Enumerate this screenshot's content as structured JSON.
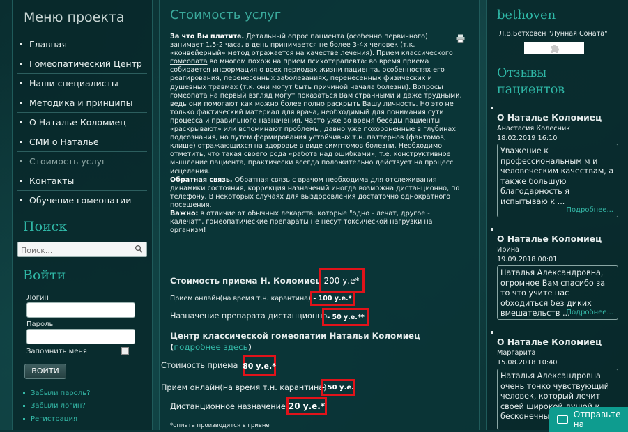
{
  "left": {
    "menu_title": "Меню проекта",
    "menu": [
      "Главная",
      "Гомеопатический Центр",
      "Наши специалисты",
      "Методика и принципы",
      "О Наталье Коломиец",
      "СМИ о Наталье",
      "Стоимость услуг",
      "Контакты",
      "Обучение гомеопатии"
    ],
    "search_title": "Поиск",
    "search_placeholder": "Поиск...",
    "login_title": "Войти",
    "login_label": "Логин",
    "password_label": "Пароль",
    "remember_label": "Запомнить меня",
    "login_button": "ВОЙТИ",
    "links": [
      "Забыли пароль?",
      "Забыли логин?",
      "Регистрация"
    ]
  },
  "main": {
    "title": "Стоимость услуг",
    "p1_bold": "За что Вы платите.",
    "p1_a": " Детальный опрос пациента (особенно первичного) занимает 1,5-2 часа, в день принимается не более 3-4х человек (т.к. «конвейерный» метод отражается на качестве лечения). Прием ",
    "p1_link": "классического гомеопата",
    "p1_b": " во многом похож на прием психотерапевта: во время приема собирается информация о всех периодах жизни пациента, особенностях его реагирования, перенесенных заболеваниях, перенесенных физических и душевных травмах (т.к. они могут быть причиной начала болезни). Вопросы гомеопата на первый взгляд могут показаться Вам странными и даже трудными, ведь они помогают как можно более полно раскрыть Вашу личность. Но это не только фактический материал для врача, необходимый для понимания сути процесса и правильного назначения. Часто уже во время беседы пациенты «раскрывают» или вспоминают проблемы, давно уже похороненные в глубинах подсознания, но путем формирования устойчивых т.н. паттернов (фантомов, клише) отражающихся на здоровье в виде симптомов болезни. Необходимо отметить, что такая своего рода «работа над ошибками», т.е. конструктивное мышление пациента, практически всегда положительно действует на процесс исцеления.",
    "p2_bold": "Обратная связь.",
    "p2": " Обратная связь с врачом необходима для отслеживания динамики состояния, коррекция назначений иногда возможна дистанционно, по телефону. В некоторых случаях для выздоровления достаточно однократного посещения.",
    "p3_bold": "Важно:",
    "p3": " в отличие от обычных лекарств, которые \"одно - лечат, другое - калечат\", гомеопатические препараты не несут токсической нагрузки на организм!",
    "price1_label": "Стоимость приема Н. Коломиец",
    "price1_value": "200 у.е*",
    "online1_label": "Прием онлайн(на время т.н. карантина)",
    "online1_value": "- 100 у.е.*",
    "remote1_label": "Назначение препарата дистанционно",
    "remote1_value": "- 50 у.е.**",
    "center_title": "Центр классической гомеопатии Натальи Коломиец",
    "center_more": "подробнее здесь",
    "price2_label": "Стоимость приема",
    "price2_value": "80 у.е.*",
    "online2_label": "Прием онлайн(на время т.н. карантина)",
    "online2_value": "- 50 у.е.",
    "remote2_label": "Дистанционное назначение",
    "remote2_value": "20 у.е.*",
    "footnote": "*оплата производится в гривне"
  },
  "right": {
    "title": "bethoven",
    "subtitle": "Л.В.Бетховен \"Лунная Соната\"",
    "reviews_title": "Отзывы пациентов",
    "reviews": [
      {
        "name": "О Наталье Коломиец",
        "author": "Анастасия Колесник",
        "date": "18.02.2019 16:10",
        "text": "Уважение к профессиональным м и человеческим качествам, а также большую благодарность я испытываю к ...",
        "more": "Подробнее..."
      },
      {
        "name": "О Наталье Коломиец",
        "author": "Ирина",
        "date": "19.09.2018 00:01",
        "text": "Наталья Александровна, огромное Вам спасибо за то что учите нас обходиться без диких вмешательств ...",
        "more": "Подробнее..."
      },
      {
        "name": "О Наталье Коломиец",
        "author": "Маргарита",
        "date": "15.08.2018 10:40",
        "text": "Наталья Александровна очень тонко чувствующий человек, который лечит своей широкой душой и бесконечны",
        "more": ""
      }
    ],
    "chat_button": "Отправьте на"
  }
}
